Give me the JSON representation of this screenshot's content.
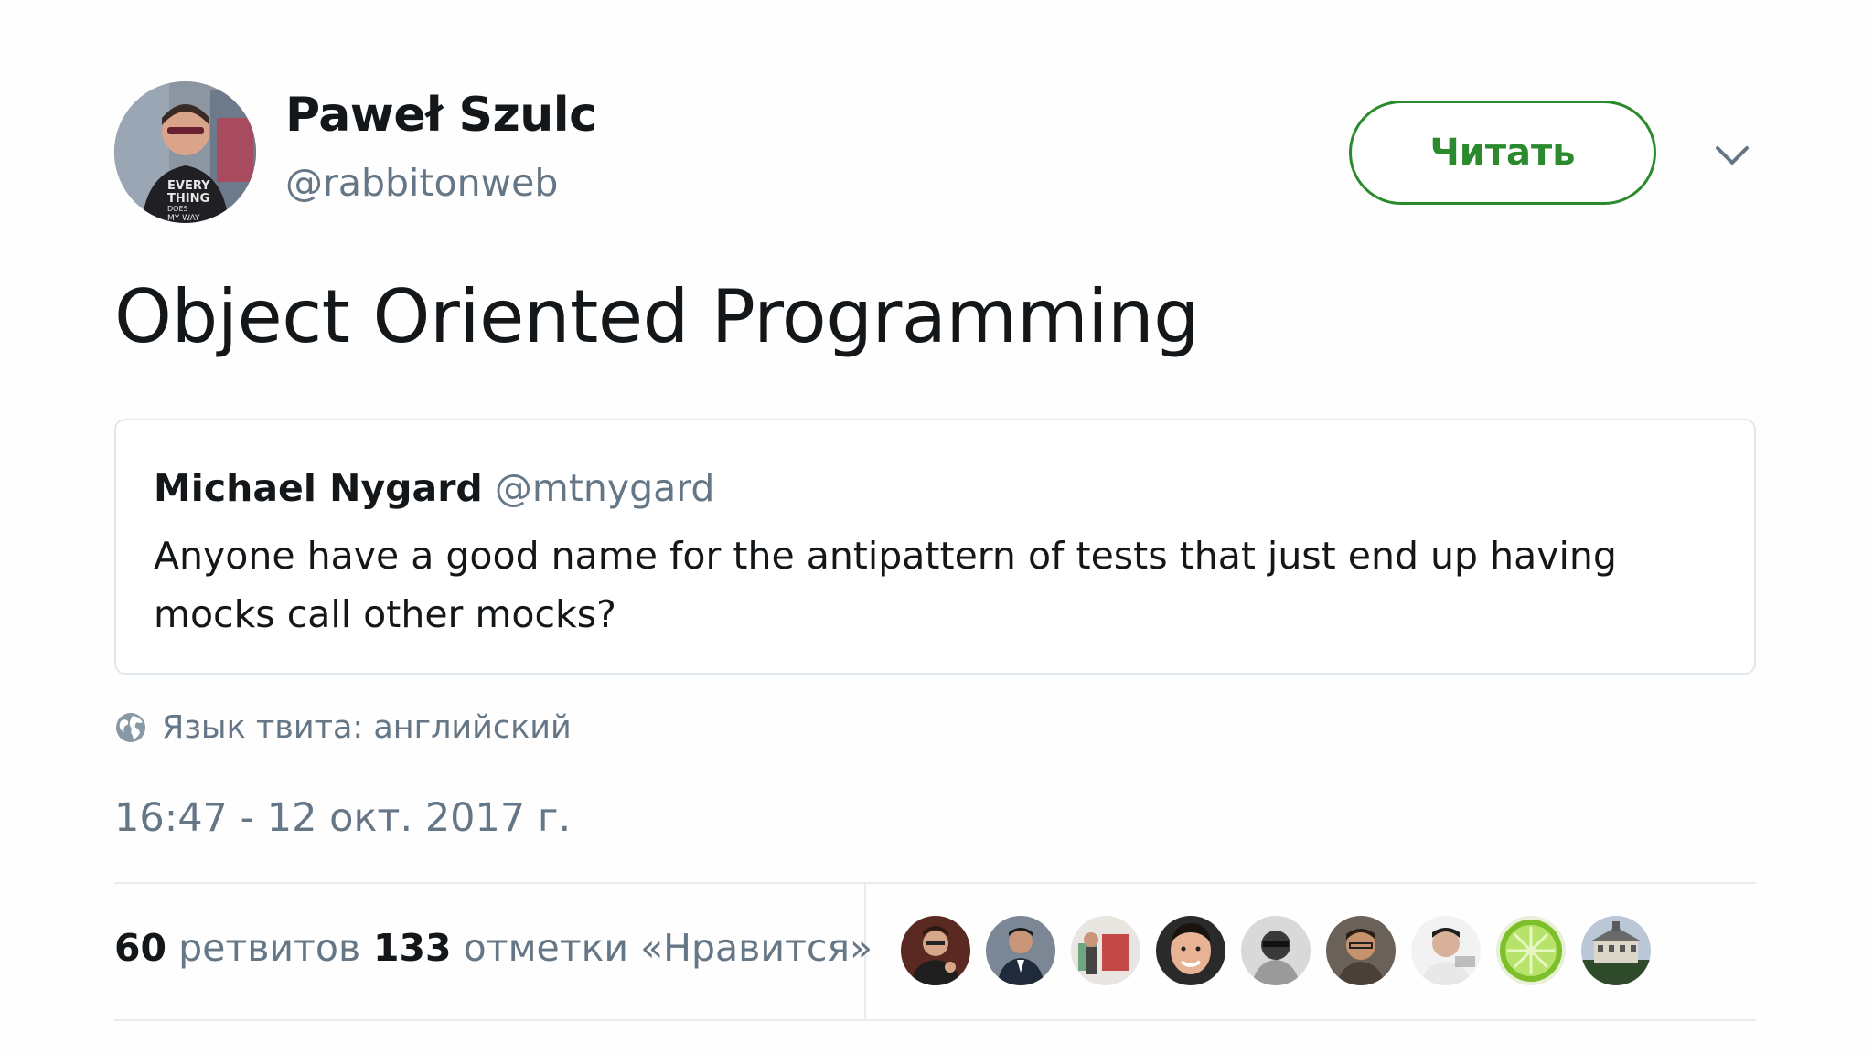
{
  "author": {
    "name": "Paweł Szulc",
    "handle": "@rabbitonweb",
    "avatar_shirt_text": "EVERY THING DOES MY WAY"
  },
  "follow_button": {
    "label": "Читать",
    "color": "#2b8a2e"
  },
  "tweet": {
    "text": "Object Oriented Programming"
  },
  "quoted_tweet": {
    "author_name": "Michael Nygard",
    "author_handle": "@mtnygard",
    "text": "Anyone have a good name for the antipattern of tests that just end up having mocks call other mocks?"
  },
  "language": {
    "icon": "globe-icon",
    "text": "Язык твита: английский"
  },
  "timestamp": "16:47 - 12 окт. 2017 г.",
  "stats": {
    "retweets_count": "60",
    "retweets_label": "ретвитов",
    "likes_count": "133",
    "likes_label": "отметки «Нравится»"
  },
  "liker_avatars_count": 9,
  "colors": {
    "text_primary": "#14171a",
    "text_secondary": "#657786",
    "border": "#e1e8ed",
    "accent_green": "#2b8a2e"
  }
}
